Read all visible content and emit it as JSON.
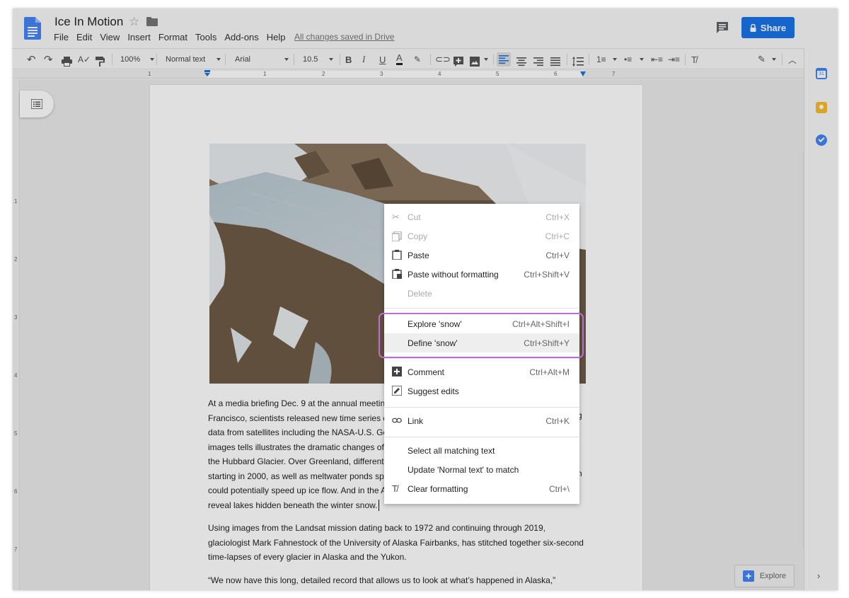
{
  "app": {
    "doc_title": "Ice In Motion",
    "saved_status": "All changes saved in Drive",
    "share_label": "Share"
  },
  "menu": [
    "File",
    "Edit",
    "View",
    "Insert",
    "Format",
    "Tools",
    "Add-ons",
    "Help"
  ],
  "toolbar": {
    "zoom": "100%",
    "style": "Normal text",
    "font": "Arial",
    "font_size": "10.5",
    "bold": "B",
    "italic": "I",
    "underline": "U",
    "text_color": "A"
  },
  "ruler": [
    "1",
    "1",
    "2",
    "3",
    "4",
    "5",
    "6",
    "7"
  ],
  "vruler": [
    "1",
    "2",
    "3",
    "4",
    "5",
    "6",
    "7"
  ],
  "document": {
    "para1": [
      "At a media briefing Dec. 9 at the annual meetin",
      "Francisco, scientists released new time series o",
      "data from satellites including the NASA-U.S. Ge",
      "images tells illustrates the dramatic changes of",
      "the Hubbard Glacier. Over Greenland, different",
      "starting in 2000, as well as meltwater ponds spi",
      "could potentially speed up ice flow. And in the A",
      "reveal lakes hidden beneath the winter snow."
    ],
    "para2": [
      "Using images from the Landsat mission dating back to 1972 and continuing through 2019,",
      "glaciologist Mark Fahnestock of the University of Alaska Fairbanks, has stitched together six-second",
      "time-lapses of every glacier in Alaska and the Yukon."
    ],
    "para3": [
      "“We now have this long, detailed record that allows us to look at what’s happened in Alaska,”"
    ],
    "edge_chars": [
      "g",
      "n"
    ]
  },
  "context_menu": {
    "items": [
      {
        "label": "Cut",
        "shortcut": "Ctrl+X",
        "icon": "cut-icon",
        "disabled": true
      },
      {
        "label": "Copy",
        "shortcut": "Ctrl+C",
        "icon": "copy-icon",
        "disabled": true
      },
      {
        "label": "Paste",
        "shortcut": "Ctrl+V",
        "icon": "paste-icon",
        "disabled": false
      },
      {
        "label": "Paste without formatting",
        "shortcut": "Ctrl+Shift+V",
        "icon": "paste-plain-icon",
        "disabled": false
      },
      {
        "label": "Delete",
        "shortcut": "",
        "icon": "",
        "disabled": true
      },
      {
        "label": "Explore 'snow'",
        "shortcut": "Ctrl+Alt+Shift+I",
        "icon": "",
        "disabled": false
      },
      {
        "label": "Define 'snow'",
        "shortcut": "Ctrl+Shift+Y",
        "icon": "",
        "disabled": false
      },
      {
        "label": "Comment",
        "shortcut": "Ctrl+Alt+M",
        "icon": "add-comment-icon",
        "disabled": false
      },
      {
        "label": "Suggest edits",
        "shortcut": "",
        "icon": "suggest-icon",
        "disabled": false
      },
      {
        "label": "Link",
        "shortcut": "Ctrl+K",
        "icon": "link-icon",
        "disabled": false
      },
      {
        "label": "Select all matching text",
        "shortcut": "",
        "icon": "",
        "disabled": false
      },
      {
        "label": "Update 'Normal text' to match",
        "shortcut": "",
        "icon": "",
        "disabled": false
      },
      {
        "label": "Clear formatting",
        "shortcut": "Ctrl+\\",
        "icon": "clear-format-icon",
        "disabled": false
      }
    ]
  },
  "explore_label": "Explore",
  "colors": {
    "accent": "#1a73e8",
    "highlight": "#c06cd6",
    "doc_icon": "#4285f4"
  }
}
